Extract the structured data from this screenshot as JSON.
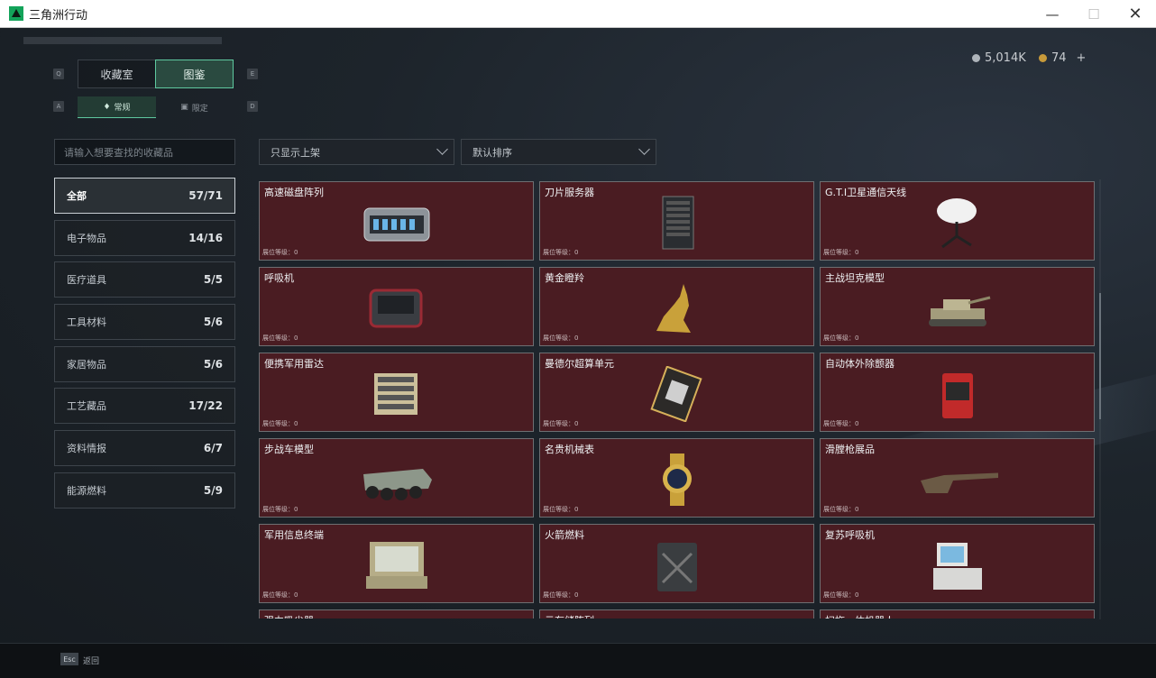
{
  "window": {
    "title": "三角洲行动"
  },
  "currency": {
    "silver": "5,014K",
    "gold": "74",
    "add": "+"
  },
  "keys": {
    "prev_tab": "Q",
    "next_tab": "E",
    "prev_sub": "A",
    "next_sub": "D",
    "esc": "Esc"
  },
  "tabs": [
    {
      "label": "收藏室"
    },
    {
      "label": "图鉴"
    }
  ],
  "subtabs": [
    {
      "label": "常规"
    },
    {
      "label": "限定"
    }
  ],
  "search": {
    "placeholder": "请输入想要查找的收藏品"
  },
  "filters": {
    "display": "只显示上架",
    "sort": "默认排序"
  },
  "categories": [
    {
      "name": "全部",
      "count": "57/71"
    },
    {
      "name": "电子物品",
      "count": "14/16"
    },
    {
      "name": "医疗道具",
      "count": "5/5"
    },
    {
      "name": "工具材料",
      "count": "5/6"
    },
    {
      "name": "家居物品",
      "count": "5/6"
    },
    {
      "name": "工艺藏品",
      "count": "17/22"
    },
    {
      "name": "资料情报",
      "count": "6/7"
    },
    {
      "name": "能源燃料",
      "count": "5/9"
    }
  ],
  "level_text": "展位等级：0",
  "items": [
    {
      "name": "高速磁盘阵列",
      "icon": "disk-array-icon"
    },
    {
      "name": "刀片服务器",
      "icon": "blade-server-icon"
    },
    {
      "name": "G.T.I卫星通信天线",
      "icon": "satellite-dish-icon"
    },
    {
      "name": "呼吸机",
      "icon": "ventilator-icon"
    },
    {
      "name": "黄金瞪羚",
      "icon": "gold-gazelle-icon"
    },
    {
      "name": "主战坦克模型",
      "icon": "tank-model-icon"
    },
    {
      "name": "便携军用雷达",
      "icon": "portable-radar-icon"
    },
    {
      "name": "曼德尔超算单元",
      "icon": "supercomputer-unit-icon"
    },
    {
      "name": "自动体外除颤器",
      "icon": "defibrillator-icon"
    },
    {
      "name": "步战车模型",
      "icon": "ifv-model-icon"
    },
    {
      "name": "名贵机械表",
      "icon": "gold-watch-icon"
    },
    {
      "name": "滑膛枪展品",
      "icon": "musket-icon"
    },
    {
      "name": "军用信息终端",
      "icon": "military-terminal-icon"
    },
    {
      "name": "火箭燃料",
      "icon": "rocket-fuel-icon"
    },
    {
      "name": "复苏呼吸机",
      "icon": "resuscitator-icon"
    },
    {
      "name": "强力吸尘器",
      "icon": "vacuum-icon"
    },
    {
      "name": "云存储阵列",
      "icon": "cloud-storage-icon"
    },
    {
      "name": "扫拖一体机器人",
      "icon": "robot-vacuum-icon"
    }
  ],
  "footer": {
    "back_label": "返回"
  },
  "colors": {
    "accent": "#5fc9a0",
    "card_bg": "#4a1c22",
    "card_border": "#6e6f72"
  }
}
